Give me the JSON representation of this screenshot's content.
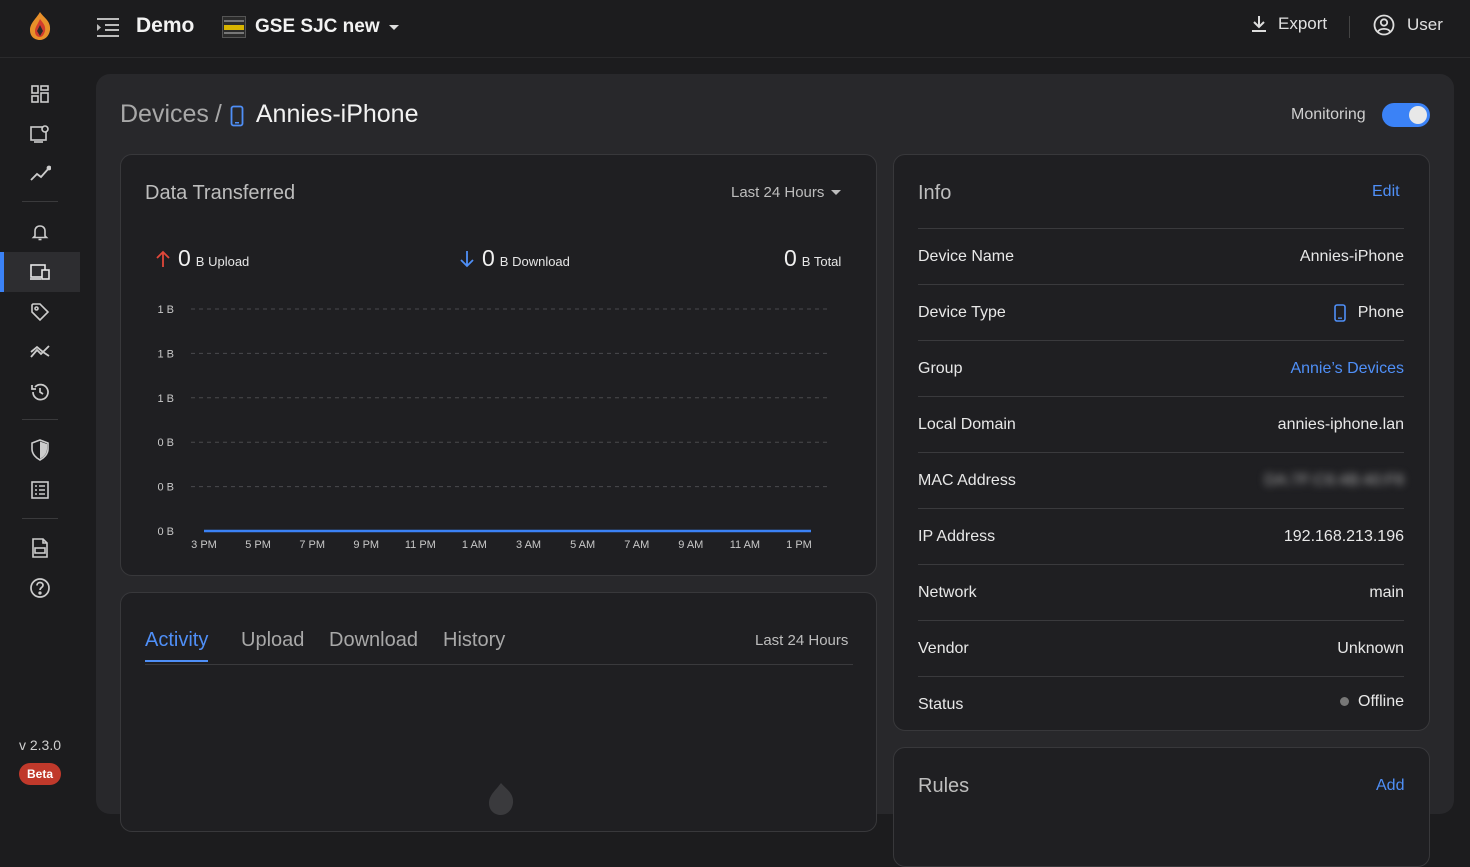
{
  "header": {
    "brand": "Demo",
    "network_name": "GSE SJC new",
    "export_label": "Export",
    "user_label": "User"
  },
  "sidebar": {
    "items": [
      {
        "name": "dashboard",
        "icon": "dashboard-icon"
      },
      {
        "name": "devices-config",
        "icon": "device-settings-icon"
      },
      {
        "name": "analytics",
        "icon": "analytics-icon"
      },
      {
        "name": "alarms",
        "icon": "bell-icon"
      },
      {
        "name": "devices",
        "icon": "devices-icon",
        "active": true
      },
      {
        "name": "tags",
        "icon": "tag-icon"
      },
      {
        "name": "trends",
        "icon": "trend-icon"
      },
      {
        "name": "history",
        "icon": "history-icon"
      },
      {
        "name": "security",
        "icon": "shield-icon"
      },
      {
        "name": "logs",
        "icon": "list-icon"
      },
      {
        "name": "api",
        "icon": "api-icon"
      },
      {
        "name": "help",
        "icon": "help-icon"
      }
    ],
    "version": "v 2.3.0",
    "beta_label": "Beta"
  },
  "page": {
    "breadcrumb_root": "Devices",
    "breadcrumb_sep": "/",
    "device_name": "Annies-iPhone",
    "monitoring_label": "Monitoring",
    "monitoring_on": true
  },
  "data_card": {
    "title": "Data Transferred",
    "range": "Last 24 Hours",
    "upload_value": "0",
    "upload_unit": "B Upload",
    "download_value": "0",
    "download_unit": "B Download",
    "total_value": "0",
    "total_unit": "B Total"
  },
  "chart_data": {
    "type": "line",
    "title": "",
    "xlabel": "",
    "ylabel": "",
    "y_tick_labels": [
      "1 B",
      "1 B",
      "1 B",
      "0 B",
      "0 B",
      "0 B"
    ],
    "x_tick_labels": [
      "3 PM",
      "5 PM",
      "7 PM",
      "9 PM",
      "11 PM",
      "1 AM",
      "3 AM",
      "5 AM",
      "7 AM",
      "9 AM",
      "11 AM",
      "1 PM"
    ],
    "series": [
      {
        "values": [
          0,
          0,
          0,
          0,
          0,
          0,
          0,
          0,
          0,
          0,
          0,
          0
        ],
        "color": "#3b82f6"
      }
    ],
    "grid": true,
    "grid_style": "dashed"
  },
  "activity_card": {
    "tabs": [
      "Activity",
      "Upload",
      "Download",
      "History"
    ],
    "active_tab": "Activity",
    "range": "Last 24 Hours"
  },
  "info_card": {
    "title": "Info",
    "edit_label": "Edit",
    "rows": [
      {
        "label": "Device Name",
        "value": "Annies-iPhone"
      },
      {
        "label": "Device Type",
        "value": "Phone"
      },
      {
        "label": "Group",
        "value": "Annie’s Devices"
      },
      {
        "label": "Local Domain",
        "value": "annies-iphone.lan"
      },
      {
        "label": "MAC Address",
        "value": "DA:7F:C6:4B:40:F8"
      },
      {
        "label": "IP Address",
        "value": "192.168.213.196"
      },
      {
        "label": "Network",
        "value": "main"
      },
      {
        "label": "Vendor",
        "value": "Unknown"
      },
      {
        "label": "Status",
        "value": "Offline"
      }
    ]
  },
  "rules_card": {
    "title": "Rules",
    "add_label": "Add"
  },
  "colors": {
    "accent": "#3b82f6",
    "link": "#4f8ff7",
    "upload_arrow": "#e0473a",
    "download_arrow": "#4f8ff7",
    "beta_badge": "#c0392b"
  }
}
